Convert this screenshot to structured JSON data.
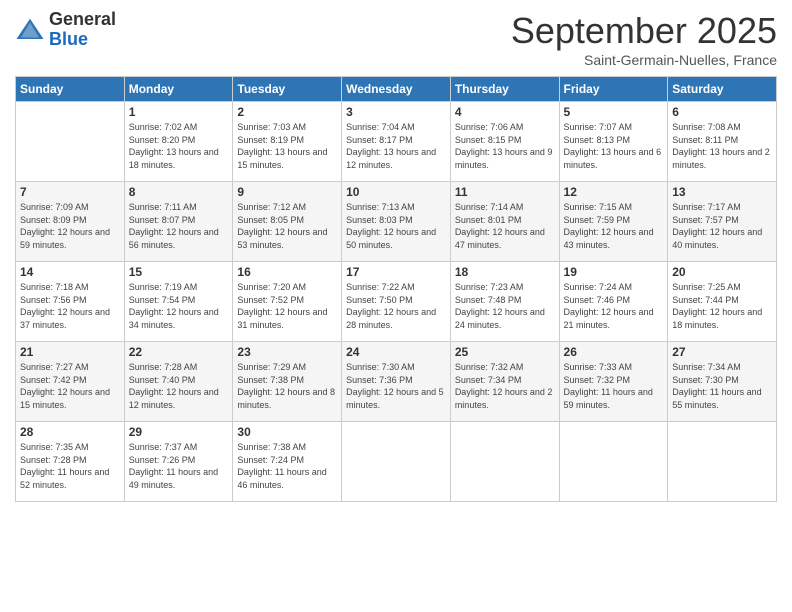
{
  "logo": {
    "general": "General",
    "blue": "Blue"
  },
  "header": {
    "month": "September 2025",
    "location": "Saint-Germain-Nuelles, France"
  },
  "weekdays": [
    "Sunday",
    "Monday",
    "Tuesday",
    "Wednesday",
    "Thursday",
    "Friday",
    "Saturday"
  ],
  "weeks": [
    [
      null,
      {
        "day": 1,
        "sunrise": "7:02 AM",
        "sunset": "8:20 PM",
        "daylight": "13 hours and 18 minutes."
      },
      {
        "day": 2,
        "sunrise": "7:03 AM",
        "sunset": "8:19 PM",
        "daylight": "13 hours and 15 minutes."
      },
      {
        "day": 3,
        "sunrise": "7:04 AM",
        "sunset": "8:17 PM",
        "daylight": "13 hours and 12 minutes."
      },
      {
        "day": 4,
        "sunrise": "7:06 AM",
        "sunset": "8:15 PM",
        "daylight": "13 hours and 9 minutes."
      },
      {
        "day": 5,
        "sunrise": "7:07 AM",
        "sunset": "8:13 PM",
        "daylight": "13 hours and 6 minutes."
      },
      {
        "day": 6,
        "sunrise": "7:08 AM",
        "sunset": "8:11 PM",
        "daylight": "13 hours and 2 minutes."
      }
    ],
    [
      {
        "day": 7,
        "sunrise": "7:09 AM",
        "sunset": "8:09 PM",
        "daylight": "12 hours and 59 minutes."
      },
      {
        "day": 8,
        "sunrise": "7:11 AM",
        "sunset": "8:07 PM",
        "daylight": "12 hours and 56 minutes."
      },
      {
        "day": 9,
        "sunrise": "7:12 AM",
        "sunset": "8:05 PM",
        "daylight": "12 hours and 53 minutes."
      },
      {
        "day": 10,
        "sunrise": "7:13 AM",
        "sunset": "8:03 PM",
        "daylight": "12 hours and 50 minutes."
      },
      {
        "day": 11,
        "sunrise": "7:14 AM",
        "sunset": "8:01 PM",
        "daylight": "12 hours and 47 minutes."
      },
      {
        "day": 12,
        "sunrise": "7:15 AM",
        "sunset": "7:59 PM",
        "daylight": "12 hours and 43 minutes."
      },
      {
        "day": 13,
        "sunrise": "7:17 AM",
        "sunset": "7:57 PM",
        "daylight": "12 hours and 40 minutes."
      }
    ],
    [
      {
        "day": 14,
        "sunrise": "7:18 AM",
        "sunset": "7:56 PM",
        "daylight": "12 hours and 37 minutes."
      },
      {
        "day": 15,
        "sunrise": "7:19 AM",
        "sunset": "7:54 PM",
        "daylight": "12 hours and 34 minutes."
      },
      {
        "day": 16,
        "sunrise": "7:20 AM",
        "sunset": "7:52 PM",
        "daylight": "12 hours and 31 minutes."
      },
      {
        "day": 17,
        "sunrise": "7:22 AM",
        "sunset": "7:50 PM",
        "daylight": "12 hours and 28 minutes."
      },
      {
        "day": 18,
        "sunrise": "7:23 AM",
        "sunset": "7:48 PM",
        "daylight": "12 hours and 24 minutes."
      },
      {
        "day": 19,
        "sunrise": "7:24 AM",
        "sunset": "7:46 PM",
        "daylight": "12 hours and 21 minutes."
      },
      {
        "day": 20,
        "sunrise": "7:25 AM",
        "sunset": "7:44 PM",
        "daylight": "12 hours and 18 minutes."
      }
    ],
    [
      {
        "day": 21,
        "sunrise": "7:27 AM",
        "sunset": "7:42 PM",
        "daylight": "12 hours and 15 minutes."
      },
      {
        "day": 22,
        "sunrise": "7:28 AM",
        "sunset": "7:40 PM",
        "daylight": "12 hours and 12 minutes."
      },
      {
        "day": 23,
        "sunrise": "7:29 AM",
        "sunset": "7:38 PM",
        "daylight": "12 hours and 8 minutes."
      },
      {
        "day": 24,
        "sunrise": "7:30 AM",
        "sunset": "7:36 PM",
        "daylight": "12 hours and 5 minutes."
      },
      {
        "day": 25,
        "sunrise": "7:32 AM",
        "sunset": "7:34 PM",
        "daylight": "12 hours and 2 minutes."
      },
      {
        "day": 26,
        "sunrise": "7:33 AM",
        "sunset": "7:32 PM",
        "daylight": "11 hours and 59 minutes."
      },
      {
        "day": 27,
        "sunrise": "7:34 AM",
        "sunset": "7:30 PM",
        "daylight": "11 hours and 55 minutes."
      }
    ],
    [
      {
        "day": 28,
        "sunrise": "7:35 AM",
        "sunset": "7:28 PM",
        "daylight": "11 hours and 52 minutes."
      },
      {
        "day": 29,
        "sunrise": "7:37 AM",
        "sunset": "7:26 PM",
        "daylight": "11 hours and 49 minutes."
      },
      {
        "day": 30,
        "sunrise": "7:38 AM",
        "sunset": "7:24 PM",
        "daylight": "11 hours and 46 minutes."
      },
      null,
      null,
      null,
      null
    ]
  ]
}
